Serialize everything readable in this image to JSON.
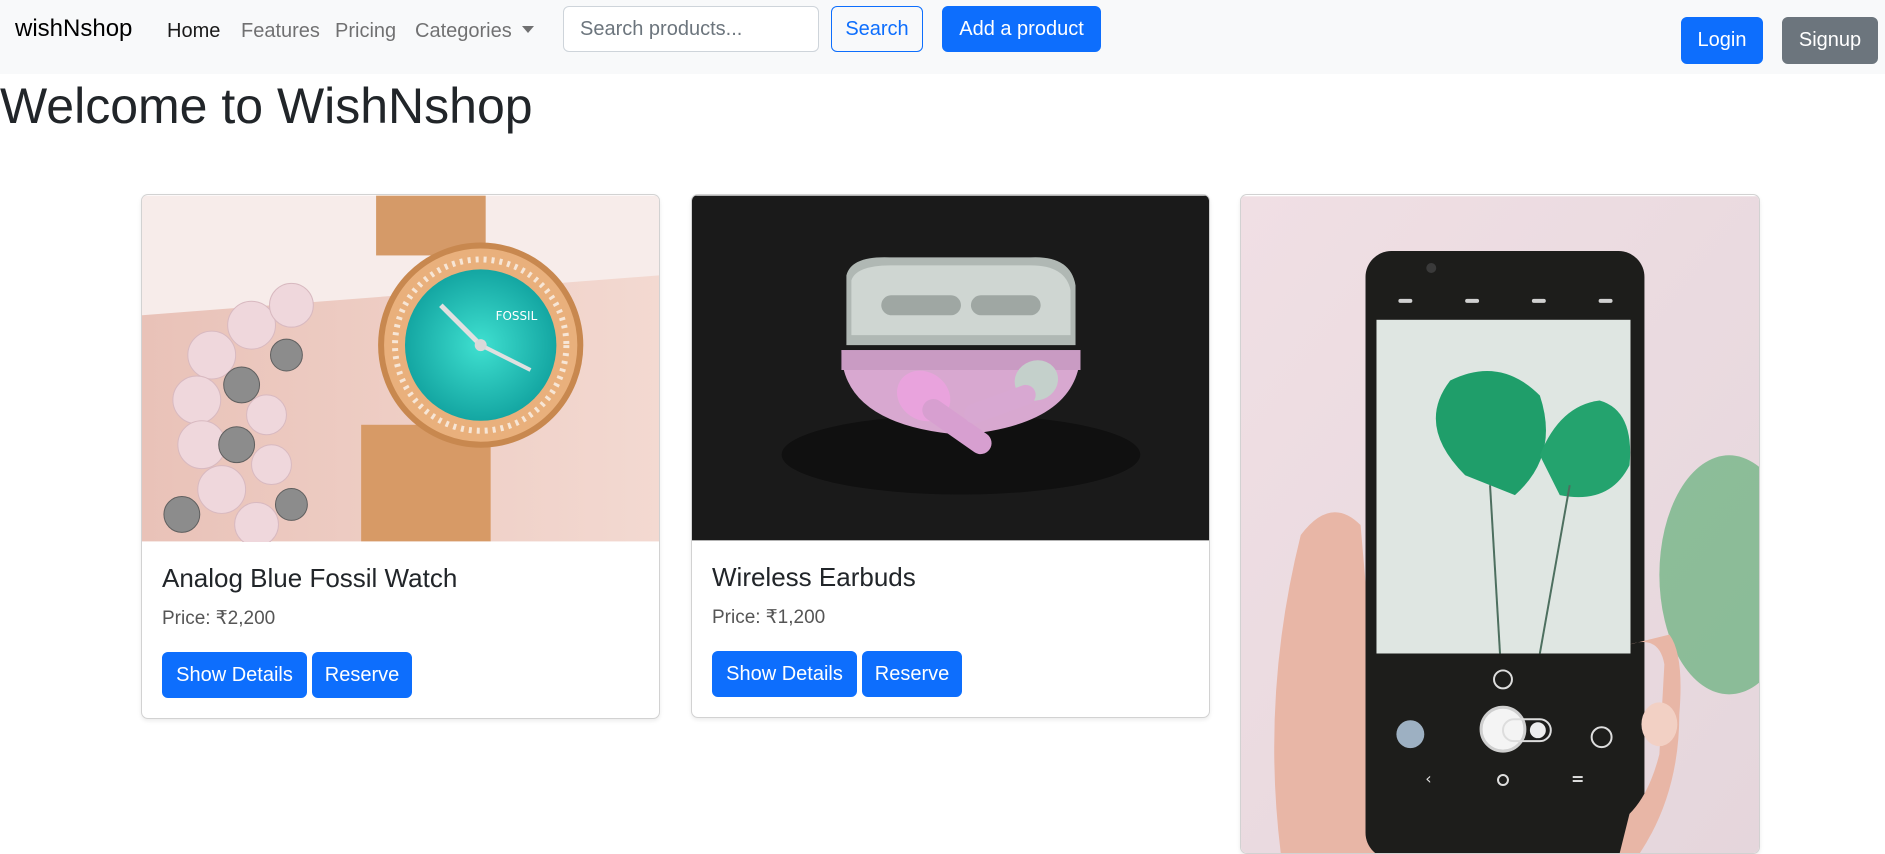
{
  "navbar": {
    "brand": "wishNshop",
    "links": [
      {
        "label": "Home"
      },
      {
        "label": "Features"
      },
      {
        "label": "Pricing"
      },
      {
        "label": "Categories"
      }
    ],
    "search_placeholder": "Search products...",
    "search_button": "Search",
    "add_product_button": "Add a product",
    "login_button": "Login",
    "signup_button": "Signup"
  },
  "main": {
    "title": "Welcome to WishNshop"
  },
  "products": [
    {
      "title": "Analog Blue Fossil Watch",
      "price_label": "Price:",
      "price": "₹2,200",
      "details_button": "Show Details",
      "reserve_button": "Reserve"
    },
    {
      "title": "Wireless Earbuds",
      "price_label": "Price:",
      "price": "₹1,200",
      "details_button": "Show Details",
      "reserve_button": "Reserve"
    }
  ],
  "colors": {
    "primary": "#0d6efd",
    "secondary": "#6c757d",
    "navbar_bg": "#f8f9fa"
  }
}
